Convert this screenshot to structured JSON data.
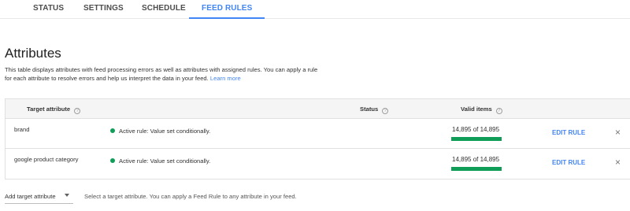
{
  "tabs": [
    {
      "label": "STATUS"
    },
    {
      "label": "SETTINGS"
    },
    {
      "label": "SCHEDULE"
    },
    {
      "label": "FEED RULES",
      "active": true
    }
  ],
  "section": {
    "title": "Attributes",
    "description": "This table displays attributes with feed processing errors as well as attributes with assigned rules. You can apply a rule for each attribute to resolve errors and help us interpret the data in your feed.",
    "learn_more": "Learn more"
  },
  "table": {
    "headers": {
      "target_attribute": "Target attribute",
      "status": "Status",
      "valid_items": "Valid items"
    },
    "rows": [
      {
        "attribute": "brand",
        "status": "Active rule: Value set conditionally.",
        "valid": "14,895 of 14,895",
        "valid_fraction": 1.0,
        "action": "EDIT RULE"
      },
      {
        "attribute": "google product category",
        "status": "Active rule: Value set conditionally.",
        "valid": "14,895 of 14,895",
        "valid_fraction": 1.0,
        "action": "EDIT RULE"
      }
    ]
  },
  "footer": {
    "add_label": "Add target attribute",
    "hint": "Select a target attribute. You can apply a Feed Rule to any attribute in your feed."
  },
  "colors": {
    "accent": "#4285f4",
    "success": "#0f9d58"
  }
}
